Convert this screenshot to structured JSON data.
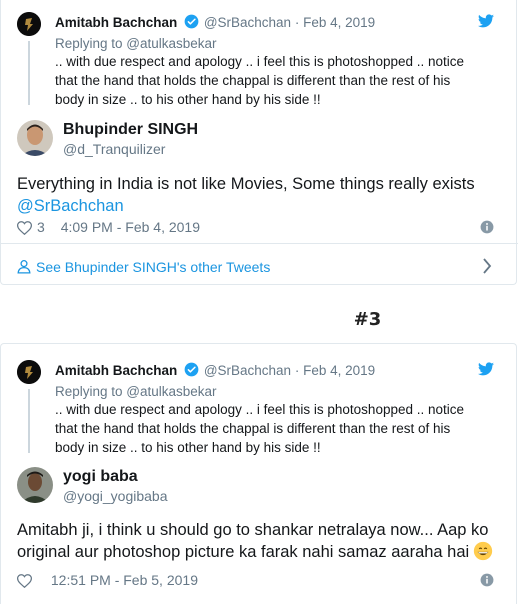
{
  "colors": {
    "link": "#1b95e0",
    "muted": "#657786",
    "text": "#14171a",
    "verified": "#1da1f2",
    "border": "#e1e8ed"
  },
  "section_label": "#3",
  "embeds": [
    {
      "quoted": {
        "name": "Amitabh Bachchan",
        "handle": "@SrBachchan",
        "separator": "·",
        "date": "Feb 4, 2019",
        "replying_to": "Replying to @atulkasbekar",
        "text": ".. with due respect and apology .. i feel this is photoshopped .. notice that the hand that holds the chappal is different than the rest of his body in size  .. to his other hand by his side !!"
      },
      "author": {
        "name": "Bhupinder SINGH",
        "handle": "@d_Tranquilizer"
      },
      "text": "Everything in India is not like Movies, Some things really exists",
      "mention": "@SrBachchan",
      "likes": "3",
      "timestamp": "4:09 PM - Feb 4, 2019",
      "see_other": "See Bhupinder SINGH's other Tweets"
    },
    {
      "quoted": {
        "name": "Amitabh Bachchan",
        "handle": "@SrBachchan",
        "separator": "·",
        "date": "Feb 4, 2019",
        "replying_to": "Replying to @atulkasbekar",
        "text": ".. with due respect and apology .. i feel this is photoshopped .. notice that the hand that holds the chappal is different than the rest of his body in size  .. to his other hand by his side !!"
      },
      "author": {
        "name": "yogi baba",
        "handle": "@yogi_yogibaba"
      },
      "text": "Amitabh ji, i think u should go to shankar netralaya now... Aap ko original aur photoshop picture ka farak nahi samaz aaraha hai",
      "emoji": "grinning-face-emoji",
      "timestamp": "12:51 PM - Feb 5, 2019"
    }
  ]
}
